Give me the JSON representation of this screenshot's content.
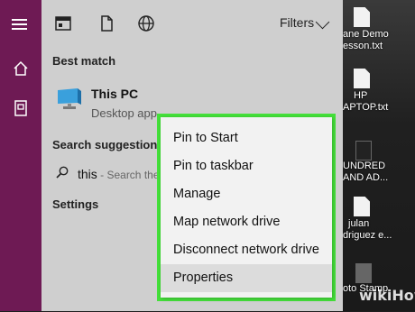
{
  "rail": {
    "icons": [
      "hamburger-menu-icon",
      "home-icon",
      "documents-icon"
    ]
  },
  "topbar": {
    "icons": [
      "apps-icon",
      "document-icon",
      "web-globe-icon"
    ],
    "filters_label": "Filters"
  },
  "best_match": {
    "heading": "Best match",
    "title": "This PC",
    "subtitle": "Desktop app"
  },
  "suggestions": {
    "heading": "Search suggestions",
    "query": "this",
    "hint": " - Search the"
  },
  "settings": {
    "heading": "Settings"
  },
  "context_menu": {
    "items": [
      {
        "label": "Pin to Start"
      },
      {
        "label": "Pin to taskbar"
      },
      {
        "label": "Manage"
      },
      {
        "label": "Map network drive"
      },
      {
        "label": "Disconnect network drive"
      },
      {
        "label": "Properties",
        "selected": true
      }
    ],
    "highlight_color": "#44e03a"
  },
  "desktop": {
    "items": [
      {
        "label1": "ane Demo",
        "label2": "esson.txt"
      },
      {
        "label1": "HP",
        "label2": "APTOP.txt"
      },
      {
        "label1": "UNDRED",
        "label2": "AND AD..."
      },
      {
        "label1": "julan",
        "label2": "driguez e..."
      },
      {
        "label1": "oto Stamp",
        "label2": ""
      }
    ]
  },
  "watermark": "wikiHow",
  "colors": {
    "rail": "#6e1a54",
    "panel": "#cfcfcf",
    "menu": "#f2f2f2"
  }
}
